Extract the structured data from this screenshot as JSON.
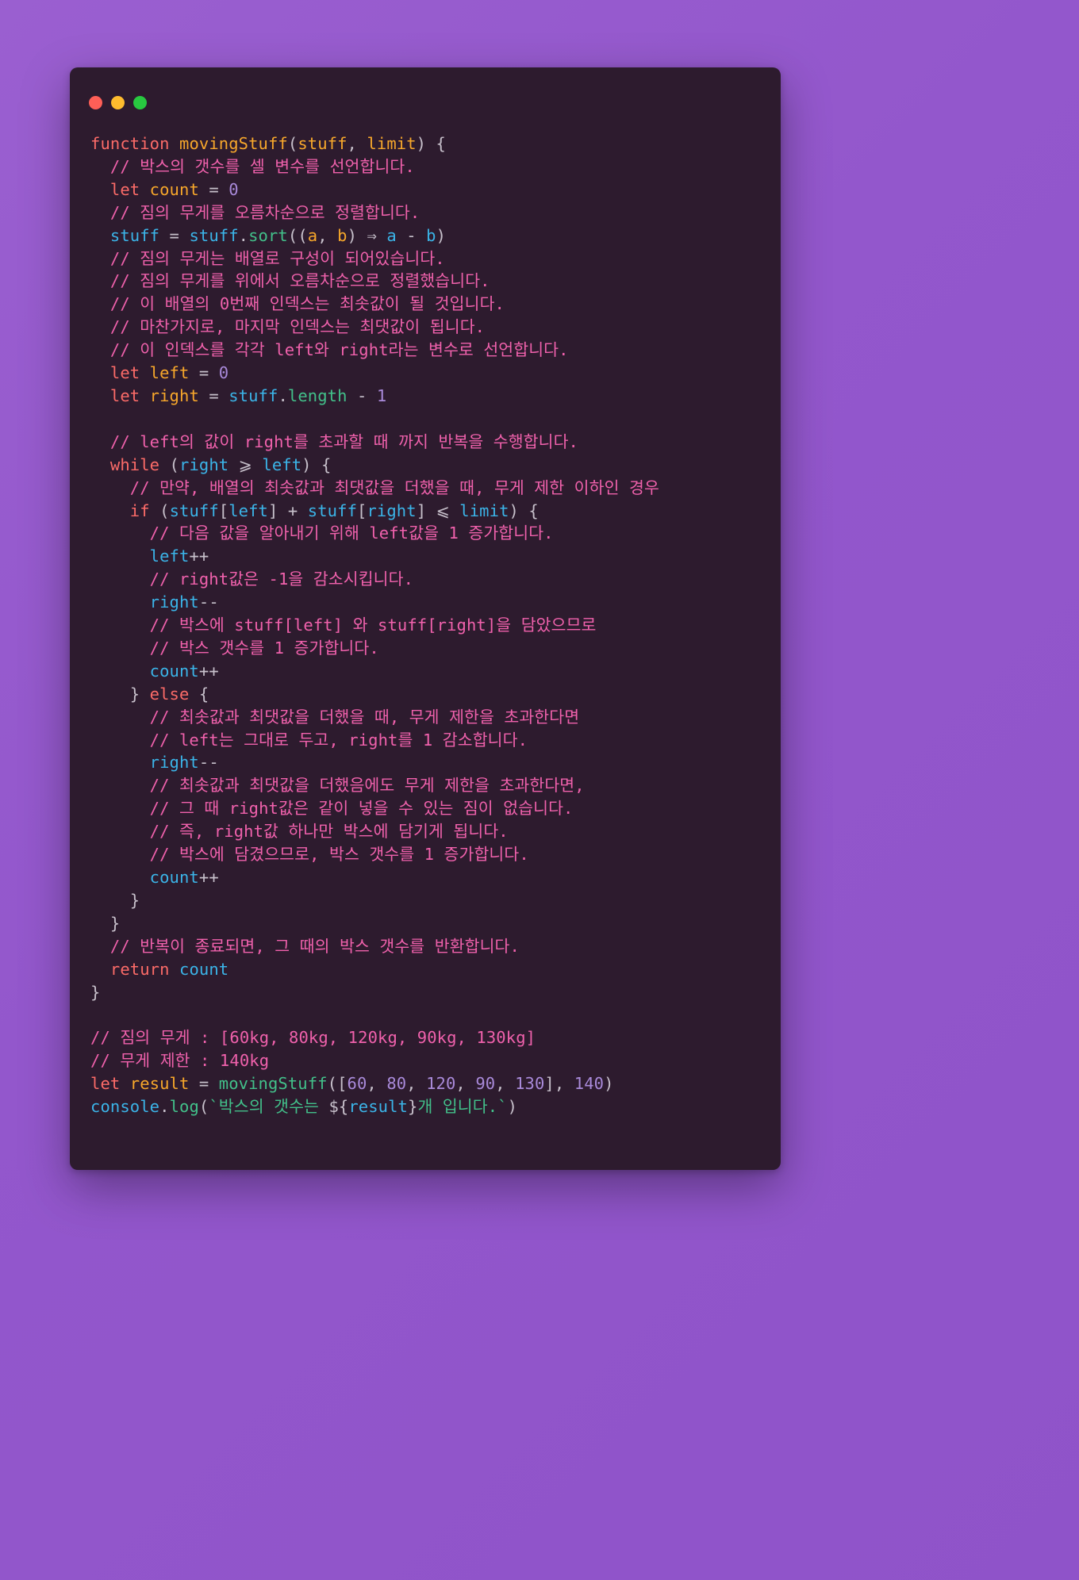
{
  "window": {
    "traffic_lights": [
      {
        "name": "close",
        "color": "#ff5f57"
      },
      {
        "name": "minimize",
        "color": "#febc2e"
      },
      {
        "name": "maximize",
        "color": "#28c840"
      }
    ],
    "background_color": "#2d1b2e",
    "page_background_color": "#9357cc"
  },
  "theme": {
    "keyword": "#fc6b68",
    "declaration": "#f7a72b",
    "variable": "#3bb4e8",
    "method": "#42c08a",
    "number": "#a98ada",
    "comment": "#f061ac",
    "punctuation": "#c7c0cb",
    "string": "#42c08a"
  },
  "code": {
    "language": "javascript",
    "lines": [
      [
        {
          "t": "function",
          "c": "kw"
        },
        {
          "t": " ",
          "c": "pun"
        },
        {
          "t": "movingStuff",
          "c": "fn"
        },
        {
          "t": "(",
          "c": "pun"
        },
        {
          "t": "stuff",
          "c": "fn"
        },
        {
          "t": ", ",
          "c": "pun"
        },
        {
          "t": "limit",
          "c": "fn"
        },
        {
          "t": ") {",
          "c": "pun"
        }
      ],
      [
        {
          "t": "  // 박스의 갯수를 셀 변수를 선언합니다.",
          "c": "cmt"
        }
      ],
      [
        {
          "t": "  ",
          "c": "pun"
        },
        {
          "t": "let",
          "c": "kw"
        },
        {
          "t": " ",
          "c": "pun"
        },
        {
          "t": "count",
          "c": "fn"
        },
        {
          "t": " = ",
          "c": "pun"
        },
        {
          "t": "0",
          "c": "num"
        }
      ],
      [
        {
          "t": "  // 짐의 무게를 오름차순으로 정렬합니다.",
          "c": "cmt"
        }
      ],
      [
        {
          "t": "  ",
          "c": "pun"
        },
        {
          "t": "stuff",
          "c": "var"
        },
        {
          "t": " = ",
          "c": "pun"
        },
        {
          "t": "stuff",
          "c": "var"
        },
        {
          "t": ".",
          "c": "pun"
        },
        {
          "t": "sort",
          "c": "meth"
        },
        {
          "t": "((",
          "c": "pun"
        },
        {
          "t": "a",
          "c": "fn"
        },
        {
          "t": ", ",
          "c": "pun"
        },
        {
          "t": "b",
          "c": "fn"
        },
        {
          "t": ") ⇒ ",
          "c": "pun"
        },
        {
          "t": "a",
          "c": "var"
        },
        {
          "t": " - ",
          "c": "pun"
        },
        {
          "t": "b",
          "c": "var"
        },
        {
          "t": ")",
          "c": "pun"
        }
      ],
      [
        {
          "t": "  // 짐의 무게는 배열로 구성이 되어있습니다.",
          "c": "cmt"
        }
      ],
      [
        {
          "t": "  // 짐의 무게를 위에서 오름차순으로 정렬했습니다.",
          "c": "cmt"
        }
      ],
      [
        {
          "t": "  // 이 배열의 0번째 인덱스는 최솟값이 될 것입니다.",
          "c": "cmt"
        }
      ],
      [
        {
          "t": "  // 마찬가지로, 마지막 인덱스는 최댓값이 됩니다.",
          "c": "cmt"
        }
      ],
      [
        {
          "t": "  // 이 인덱스를 각각 left와 right라는 변수로 선언합니다.",
          "c": "cmt"
        }
      ],
      [
        {
          "t": "  ",
          "c": "pun"
        },
        {
          "t": "let",
          "c": "kw"
        },
        {
          "t": " ",
          "c": "pun"
        },
        {
          "t": "left",
          "c": "fn"
        },
        {
          "t": " = ",
          "c": "pun"
        },
        {
          "t": "0",
          "c": "num"
        }
      ],
      [
        {
          "t": "  ",
          "c": "pun"
        },
        {
          "t": "let",
          "c": "kw"
        },
        {
          "t": " ",
          "c": "pun"
        },
        {
          "t": "right",
          "c": "fn"
        },
        {
          "t": " = ",
          "c": "pun"
        },
        {
          "t": "stuff",
          "c": "var"
        },
        {
          "t": ".",
          "c": "pun"
        },
        {
          "t": "length",
          "c": "meth"
        },
        {
          "t": " - ",
          "c": "pun"
        },
        {
          "t": "1",
          "c": "num"
        }
      ],
      [
        {
          "t": "",
          "c": "pun"
        }
      ],
      [
        {
          "t": "  // left의 값이 right를 초과할 때 까지 반복을 수행합니다.",
          "c": "cmt"
        }
      ],
      [
        {
          "t": "  ",
          "c": "pun"
        },
        {
          "t": "while",
          "c": "kw"
        },
        {
          "t": " (",
          "c": "pun"
        },
        {
          "t": "right",
          "c": "var"
        },
        {
          "t": " ⩾ ",
          "c": "pun"
        },
        {
          "t": "left",
          "c": "var"
        },
        {
          "t": ") {",
          "c": "pun"
        }
      ],
      [
        {
          "t": "    // 만약, 배열의 최솟값과 최댓값을 더했을 때, 무게 제한 이하인 경우",
          "c": "cmt"
        }
      ],
      [
        {
          "t": "    ",
          "c": "pun"
        },
        {
          "t": "if",
          "c": "kw"
        },
        {
          "t": " (",
          "c": "pun"
        },
        {
          "t": "stuff",
          "c": "var"
        },
        {
          "t": "[",
          "c": "pun"
        },
        {
          "t": "left",
          "c": "var"
        },
        {
          "t": "] + ",
          "c": "pun"
        },
        {
          "t": "stuff",
          "c": "var"
        },
        {
          "t": "[",
          "c": "pun"
        },
        {
          "t": "right",
          "c": "var"
        },
        {
          "t": "] ⩽ ",
          "c": "pun"
        },
        {
          "t": "limit",
          "c": "var"
        },
        {
          "t": ") {",
          "c": "pun"
        }
      ],
      [
        {
          "t": "      // 다음 값을 알아내기 위해 left값을 1 증가합니다.",
          "c": "cmt"
        }
      ],
      [
        {
          "t": "      ",
          "c": "pun"
        },
        {
          "t": "left",
          "c": "var"
        },
        {
          "t": "++",
          "c": "pun"
        }
      ],
      [
        {
          "t": "      // right값은 -1을 감소시킵니다.",
          "c": "cmt"
        }
      ],
      [
        {
          "t": "      ",
          "c": "pun"
        },
        {
          "t": "right",
          "c": "var"
        },
        {
          "t": "--",
          "c": "pun"
        }
      ],
      [
        {
          "t": "      // 박스에 stuff[left] 와 stuff[right]을 담았으므로",
          "c": "cmt"
        }
      ],
      [
        {
          "t": "      // 박스 갯수를 1 증가합니다.",
          "c": "cmt"
        }
      ],
      [
        {
          "t": "      ",
          "c": "pun"
        },
        {
          "t": "count",
          "c": "var"
        },
        {
          "t": "++",
          "c": "pun"
        }
      ],
      [
        {
          "t": "    } ",
          "c": "pun"
        },
        {
          "t": "else",
          "c": "kw"
        },
        {
          "t": " {",
          "c": "pun"
        }
      ],
      [
        {
          "t": "      // 최솟값과 최댓값을 더했을 때, 무게 제한을 초과한다면",
          "c": "cmt"
        }
      ],
      [
        {
          "t": "      // left는 그대로 두고, right를 1 감소합니다.",
          "c": "cmt"
        }
      ],
      [
        {
          "t": "      ",
          "c": "pun"
        },
        {
          "t": "right",
          "c": "var"
        },
        {
          "t": "--",
          "c": "pun"
        }
      ],
      [
        {
          "t": "      // 최솟값과 최댓값을 더했음에도 무게 제한을 초과한다면,",
          "c": "cmt"
        }
      ],
      [
        {
          "t": "      // 그 때 right값은 같이 넣을 수 있는 짐이 없습니다.",
          "c": "cmt"
        }
      ],
      [
        {
          "t": "      // 즉, right값 하나만 박스에 담기게 됩니다.",
          "c": "cmt"
        }
      ],
      [
        {
          "t": "      // 박스에 담겼으므로, 박스 갯수를 1 증가합니다.",
          "c": "cmt"
        }
      ],
      [
        {
          "t": "      ",
          "c": "pun"
        },
        {
          "t": "count",
          "c": "var"
        },
        {
          "t": "++",
          "c": "pun"
        }
      ],
      [
        {
          "t": "    }",
          "c": "pun"
        }
      ],
      [
        {
          "t": "  }",
          "c": "pun"
        }
      ],
      [
        {
          "t": "  // 반복이 종료되면, 그 때의 박스 갯수를 반환합니다.",
          "c": "cmt"
        }
      ],
      [
        {
          "t": "  ",
          "c": "pun"
        },
        {
          "t": "return",
          "c": "kw"
        },
        {
          "t": " ",
          "c": "pun"
        },
        {
          "t": "count",
          "c": "var"
        }
      ],
      [
        {
          "t": "}",
          "c": "pun"
        }
      ],
      [
        {
          "t": "",
          "c": "pun"
        }
      ],
      [
        {
          "t": "// 짐의 무게 : [60kg, 80kg, 120kg, 90kg, 130kg]",
          "c": "cmt"
        }
      ],
      [
        {
          "t": "// 무게 제한 : 140kg",
          "c": "cmt"
        }
      ],
      [
        {
          "t": "let",
          "c": "kw"
        },
        {
          "t": " ",
          "c": "pun"
        },
        {
          "t": "result",
          "c": "fn"
        },
        {
          "t": " = ",
          "c": "pun"
        },
        {
          "t": "movingStuff",
          "c": "meth"
        },
        {
          "t": "([",
          "c": "pun"
        },
        {
          "t": "60",
          "c": "num"
        },
        {
          "t": ", ",
          "c": "pun"
        },
        {
          "t": "80",
          "c": "num"
        },
        {
          "t": ", ",
          "c": "pun"
        },
        {
          "t": "120",
          "c": "num"
        },
        {
          "t": ", ",
          "c": "pun"
        },
        {
          "t": "90",
          "c": "num"
        },
        {
          "t": ", ",
          "c": "pun"
        },
        {
          "t": "130",
          "c": "num"
        },
        {
          "t": "], ",
          "c": "pun"
        },
        {
          "t": "140",
          "c": "num"
        },
        {
          "t": ")",
          "c": "pun"
        }
      ],
      [
        {
          "t": "console",
          "c": "var"
        },
        {
          "t": ".",
          "c": "pun"
        },
        {
          "t": "log",
          "c": "meth"
        },
        {
          "t": "(",
          "c": "pun"
        },
        {
          "t": "`박스의 갯수는 ",
          "c": "str"
        },
        {
          "t": "${",
          "c": "pun"
        },
        {
          "t": "result",
          "c": "var"
        },
        {
          "t": "}",
          "c": "pun"
        },
        {
          "t": "개 입니다.`",
          "c": "str"
        },
        {
          "t": ")",
          "c": "pun"
        }
      ]
    ]
  }
}
